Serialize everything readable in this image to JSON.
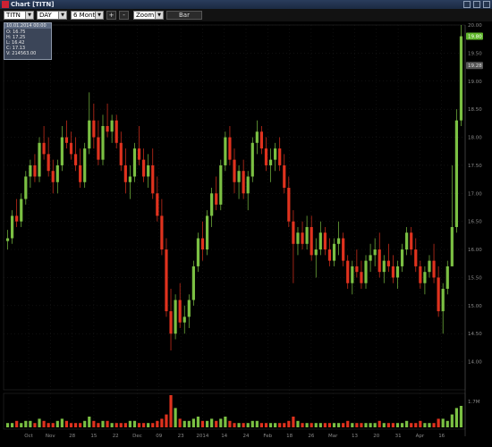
{
  "window": {
    "title": "Chart [TITN]"
  },
  "toolbar": {
    "symbol": "TITN",
    "interval": "DAY",
    "range": "6 Months",
    "zoom_in": "+",
    "zoom_out": "-",
    "zoom": "Zoom",
    "chart_type": "Bar"
  },
  "infobox": {
    "date": "10.01.2014 00:00",
    "open": "O: 16.75",
    "high": "H: 17.25",
    "low": "L: 16.42",
    "close": "C: 17.13",
    "volume": "V: 214563.00"
  },
  "price_tags": {
    "last": "19.80",
    "current": "19.28"
  },
  "chart_data": {
    "type": "candlestick",
    "colors": {
      "up": "#7bc043",
      "down": "#e0321e",
      "last_tag": "#5fb52a"
    },
    "price_axis": {
      "min": 13.5,
      "max": 20.0,
      "ticks": [
        "20.00",
        "19.50",
        "19.00",
        "18.50",
        "18.00",
        "17.50",
        "17.00",
        "16.50",
        "16.00",
        "15.50",
        "15.00",
        "14.50",
        "14.00"
      ]
    },
    "volume_axis": {
      "ticks": [
        "1.7M"
      ]
    },
    "x_labels": [
      "Oct",
      "Nov",
      "28",
      "15",
      "22",
      "Dec",
      "09",
      "23",
      "2014",
      "14",
      "24",
      "Feb",
      "18",
      "26",
      "Mar",
      "13",
      "20",
      "31",
      "Apr",
      "16"
    ],
    "ohlc": [
      [
        16.15,
        16.35,
        16.0,
        16.2
      ],
      [
        16.2,
        16.7,
        16.1,
        16.6
      ],
      [
        16.6,
        16.9,
        16.4,
        16.5
      ],
      [
        16.5,
        17.0,
        16.4,
        16.9
      ],
      [
        16.9,
        17.4,
        16.8,
        17.3
      ],
      [
        17.3,
        17.6,
        17.1,
        17.5
      ],
      [
        17.5,
        17.7,
        17.2,
        17.3
      ],
      [
        17.3,
        18.0,
        17.2,
        17.9
      ],
      [
        17.9,
        18.2,
        17.6,
        17.7
      ],
      [
        17.7,
        18.0,
        17.3,
        17.4
      ],
      [
        17.4,
        17.6,
        17.0,
        17.2
      ],
      [
        17.2,
        17.6,
        17.0,
        17.5
      ],
      [
        17.5,
        18.2,
        17.4,
        18.0
      ],
      [
        18.0,
        18.3,
        17.8,
        17.9
      ],
      [
        17.9,
        18.1,
        17.6,
        17.7
      ],
      [
        17.7,
        18.0,
        17.4,
        17.5
      ],
      [
        17.5,
        17.8,
        17.1,
        17.2
      ],
      [
        17.2,
        17.9,
        17.1,
        17.8
      ],
      [
        17.8,
        18.8,
        17.7,
        18.3
      ],
      [
        18.3,
        18.6,
        17.8,
        18.0
      ],
      [
        18.0,
        18.3,
        17.5,
        17.6
      ],
      [
        17.6,
        18.4,
        17.5,
        18.2
      ],
      [
        18.2,
        18.6,
        18.0,
        18.1
      ],
      [
        18.1,
        18.4,
        17.9,
        18.3
      ],
      [
        18.3,
        18.4,
        17.8,
        17.9
      ],
      [
        17.9,
        18.1,
        17.4,
        17.5
      ],
      [
        17.5,
        17.8,
        17.0,
        17.2
      ],
      [
        17.2,
        17.5,
        16.9,
        17.3
      ],
      [
        17.3,
        17.9,
        17.2,
        17.8
      ],
      [
        17.8,
        18.2,
        17.5,
        17.6
      ],
      [
        17.6,
        17.8,
        17.2,
        17.3
      ],
      [
        17.3,
        17.7,
        17.1,
        17.5
      ],
      [
        17.5,
        17.8,
        16.9,
        17.0
      ],
      [
        17.0,
        17.3,
        16.5,
        16.6
      ],
      [
        16.6,
        16.9,
        15.9,
        16.0
      ],
      [
        16.0,
        16.2,
        14.8,
        14.9
      ],
      [
        14.9,
        15.3,
        14.2,
        14.5
      ],
      [
        14.5,
        15.2,
        14.4,
        15.1
      ],
      [
        15.1,
        15.4,
        14.6,
        14.7
      ],
      [
        14.7,
        15.0,
        14.5,
        14.8
      ],
      [
        14.8,
        15.2,
        14.6,
        15.1
      ],
      [
        15.1,
        15.8,
        15.0,
        15.7
      ],
      [
        15.7,
        16.3,
        15.6,
        16.2
      ],
      [
        16.2,
        16.5,
        15.8,
        16.0
      ],
      [
        16.0,
        16.7,
        15.9,
        16.6
      ],
      [
        16.6,
        17.1,
        16.4,
        17.0
      ],
      [
        17.0,
        17.3,
        16.7,
        16.8
      ],
      [
        16.8,
        17.6,
        16.7,
        17.5
      ],
      [
        17.5,
        18.1,
        17.4,
        18.0
      ],
      [
        18.0,
        18.2,
        17.5,
        17.6
      ],
      [
        17.6,
        17.8,
        17.0,
        17.2
      ],
      [
        17.2,
        17.5,
        16.9,
        17.4
      ],
      [
        17.4,
        17.6,
        16.9,
        17.0
      ],
      [
        17.0,
        17.4,
        16.7,
        17.3
      ],
      [
        17.3,
        18.0,
        17.2,
        17.9
      ],
      [
        17.9,
        18.3,
        17.7,
        18.1
      ],
      [
        18.1,
        18.2,
        17.7,
        17.8
      ],
      [
        17.8,
        18.0,
        17.4,
        17.5
      ],
      [
        17.5,
        17.8,
        17.2,
        17.6
      ],
      [
        17.6,
        17.9,
        17.4,
        17.8
      ],
      [
        17.8,
        18.0,
        17.4,
        17.5
      ],
      [
        17.5,
        17.7,
        17.0,
        17.1
      ],
      [
        17.1,
        17.3,
        16.4,
        16.5
      ],
      [
        16.5,
        16.7,
        15.4,
        16.1
      ],
      [
        16.1,
        16.4,
        15.9,
        16.3
      ],
      [
        16.3,
        16.5,
        16.0,
        16.1
      ],
      [
        16.1,
        16.6,
        16.0,
        16.4
      ],
      [
        16.4,
        16.6,
        15.8,
        15.9
      ],
      [
        15.9,
        16.2,
        15.5,
        16.0
      ],
      [
        16.0,
        16.5,
        15.9,
        16.3
      ],
      [
        16.3,
        16.4,
        15.9,
        16.0
      ],
      [
        16.0,
        16.2,
        15.7,
        15.8
      ],
      [
        15.8,
        16.2,
        15.7,
        16.1
      ],
      [
        16.1,
        16.5,
        15.9,
        16.2
      ],
      [
        16.2,
        16.3,
        15.7,
        15.8
      ],
      [
        15.8,
        15.9,
        15.3,
        15.4
      ],
      [
        15.4,
        15.8,
        15.2,
        15.7
      ],
      [
        15.7,
        16.0,
        15.5,
        15.6
      ],
      [
        15.6,
        15.8,
        15.3,
        15.4
      ],
      [
        15.4,
        15.9,
        15.3,
        15.8
      ],
      [
        15.8,
        16.1,
        15.6,
        15.9
      ],
      [
        15.9,
        16.2,
        15.7,
        16.0
      ],
      [
        16.0,
        16.3,
        15.5,
        15.6
      ],
      [
        15.6,
        15.9,
        15.4,
        15.8
      ],
      [
        15.8,
        16.1,
        15.6,
        15.7
      ],
      [
        15.7,
        15.9,
        15.4,
        15.5
      ],
      [
        15.5,
        15.8,
        15.3,
        15.7
      ],
      [
        15.7,
        16.1,
        15.6,
        16.0
      ],
      [
        16.0,
        16.4,
        15.9,
        16.3
      ],
      [
        16.3,
        16.4,
        15.9,
        16.0
      ],
      [
        16.0,
        16.2,
        15.6,
        15.7
      ],
      [
        15.7,
        15.8,
        15.3,
        15.4
      ],
      [
        15.4,
        15.7,
        15.2,
        15.6
      ],
      [
        15.6,
        15.9,
        15.5,
        15.8
      ],
      [
        15.8,
        16.1,
        15.4,
        15.5
      ],
      [
        15.5,
        15.7,
        14.8,
        14.9
      ],
      [
        14.9,
        15.4,
        14.5,
        15.3
      ],
      [
        15.3,
        15.8,
        15.2,
        15.7
      ],
      [
        15.7,
        17.5,
        15.7,
        16.4
      ],
      [
        16.4,
        18.5,
        16.3,
        18.3
      ],
      [
        18.3,
        20.0,
        18.2,
        19.8
      ]
    ],
    "volume": [
      2,
      2,
      3,
      2,
      3,
      3,
      2,
      4,
      3,
      2,
      2,
      3,
      4,
      3,
      2,
      2,
      2,
      3,
      5,
      3,
      2,
      3,
      3,
      2,
      2,
      2,
      2,
      3,
      3,
      2,
      2,
      2,
      2,
      3,
      4,
      6,
      15,
      9,
      4,
      3,
      3,
      4,
      5,
      3,
      3,
      4,
      3,
      4,
      5,
      3,
      2,
      2,
      2,
      2,
      3,
      3,
      2,
      2,
      2,
      2,
      2,
      2,
      3,
      5,
      3,
      2,
      2,
      2,
      2,
      2,
      2,
      2,
      2,
      2,
      2,
      3,
      2,
      2,
      2,
      2,
      2,
      2,
      3,
      2,
      2,
      2,
      2,
      2,
      3,
      2,
      2,
      3,
      2,
      2,
      2,
      4,
      4,
      3,
      6,
      9,
      10
    ]
  }
}
